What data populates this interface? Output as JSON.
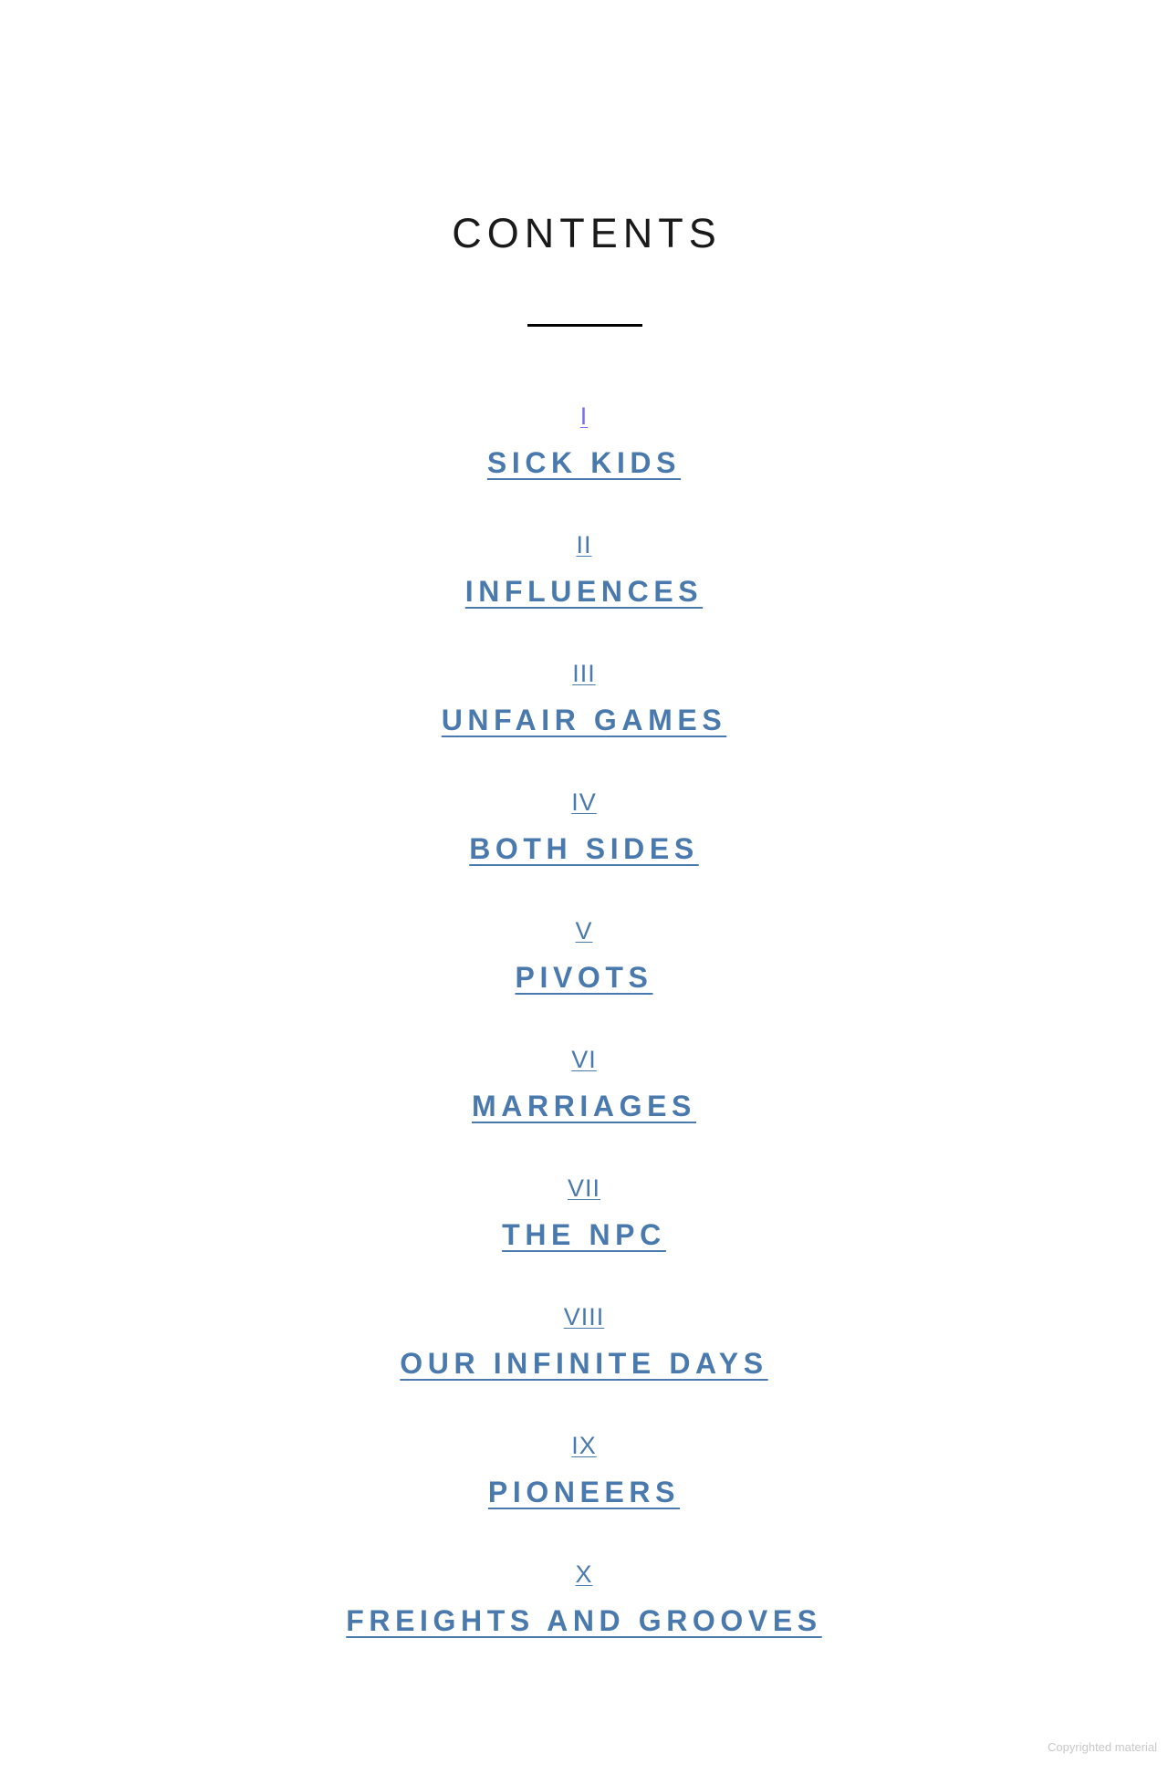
{
  "page": {
    "title": "CONTENTS",
    "footer": "Copyrighted material"
  },
  "toc": [
    {
      "numeral": "I",
      "title": "SICK KIDS"
    },
    {
      "numeral": "II",
      "title": "INFLUENCES"
    },
    {
      "numeral": "III",
      "title": "UNFAIR GAMES"
    },
    {
      "numeral": "IV",
      "title": "BOTH SIDES"
    },
    {
      "numeral": "V",
      "title": "PIVOTS"
    },
    {
      "numeral": "VI",
      "title": "MARRIAGES"
    },
    {
      "numeral": "VII",
      "title": "THE NPC"
    },
    {
      "numeral": "VIII",
      "title": "OUR INFINITE DAYS"
    },
    {
      "numeral": "IX",
      "title": "PIONEERS"
    },
    {
      "numeral": "X",
      "title": "FREIGHTS AND GROOVES"
    }
  ],
  "colors": {
    "link": "#4a7aad",
    "visited_first_numeral": "#7b6ff0",
    "heading": "#1a1a1a",
    "rule": "#000000",
    "footer": "#c8c8c8"
  }
}
